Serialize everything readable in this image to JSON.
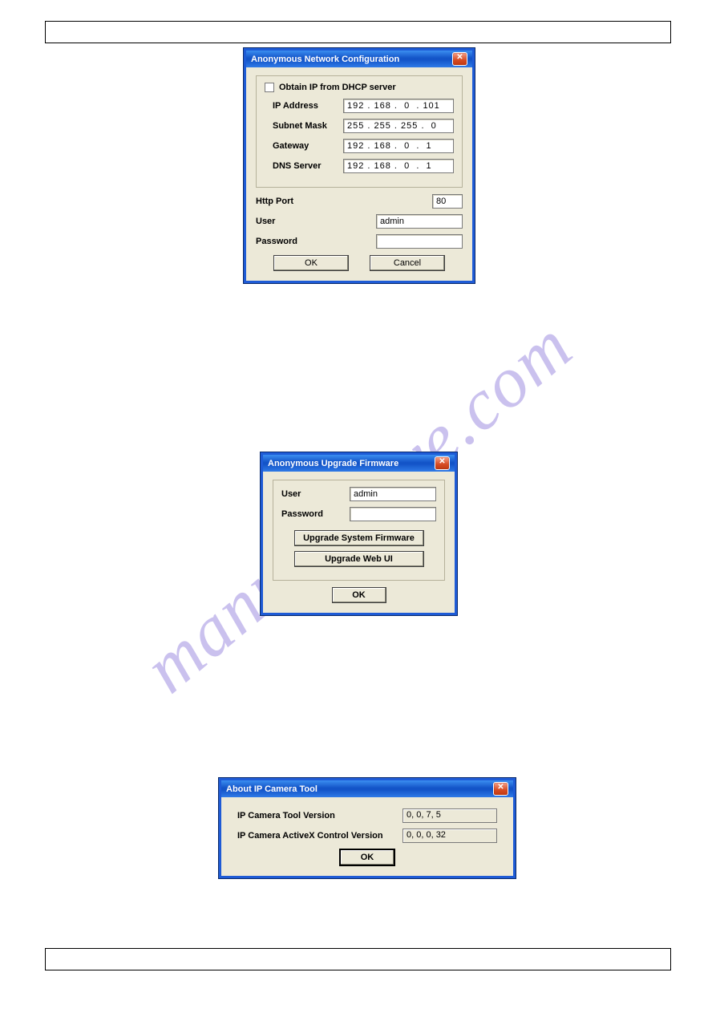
{
  "watermark": "manualchive.com",
  "dialogs": {
    "network": {
      "title": "Anonymous Network Configuration",
      "dhcp_label": "Obtain IP from DHCP server",
      "fields": {
        "ip_label": "IP Address",
        "ip_value": "192 . 168 .  0  . 101",
        "subnet_label": "Subnet Mask",
        "subnet_value": "255 . 255 . 255 .  0",
        "gateway_label": "Gateway",
        "gateway_value": "192 . 168 .  0  .  1",
        "dns_label": "DNS Server",
        "dns_value": "192 . 168 .  0  .  1"
      },
      "http_port_label": "Http Port",
      "http_port_value": "80",
      "user_label": "User",
      "user_value": "admin",
      "password_label": "Password",
      "password_value": "",
      "ok_label": "OK",
      "cancel_label": "Cancel"
    },
    "upgrade": {
      "title": "Anonymous Upgrade Firmware",
      "user_label": "User",
      "user_value": "admin",
      "password_label": "Password",
      "password_value": "",
      "btn_system": "Upgrade System Firmware",
      "btn_webui": "Upgrade Web UI",
      "ok_label": "OK"
    },
    "about": {
      "title": "About IP Camera Tool",
      "tool_label": "IP Camera Tool Version",
      "tool_value": "0, 0, 7, 5",
      "activex_label": "IP Camera ActiveX Control Version",
      "activex_value": "0, 0, 0, 32",
      "ok_label": "OK"
    }
  }
}
